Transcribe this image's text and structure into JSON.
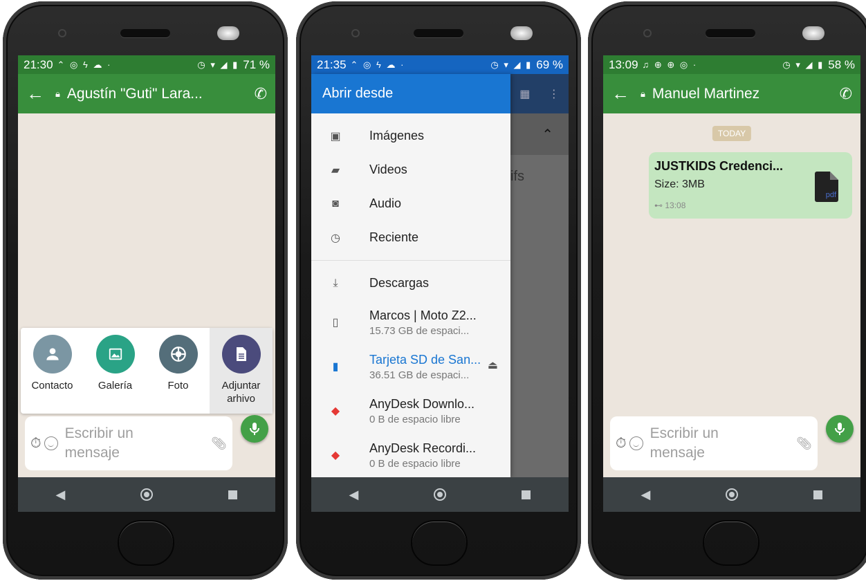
{
  "phone1": {
    "status": {
      "time": "21:30",
      "left_icons": "⌃ ◎ ϟ ☁ ·",
      "right_icons": "◷ ▾ ◢ ▮",
      "battery": "71 %"
    },
    "header": {
      "title": "Agustín \"Guti\" Lara..."
    },
    "attach": [
      {
        "label": "Contacto",
        "color": "#7b96a3"
      },
      {
        "label": "Galería",
        "color": "#2aa386"
      },
      {
        "label": "Foto",
        "color": "#546e7a"
      },
      {
        "label": "Adjuntar arhivo",
        "color": "#4b4b7c"
      }
    ],
    "input": {
      "placeholder_line1": "Escribir un",
      "placeholder_line2": "mensaje"
    }
  },
  "phone2": {
    "status": {
      "time": "21:35",
      "left_icons": "⌃ ◎ ϟ ☁ ·",
      "right_icons": "◷ ▾ ◢ ▮",
      "battery": "69 %"
    },
    "drawer_title": "Abrir desde",
    "items": [
      {
        "label": "Imágenes",
        "icon": "image-icon"
      },
      {
        "label": "Videos",
        "icon": "video-icon"
      },
      {
        "label": "Audio",
        "icon": "audio-icon"
      },
      {
        "label": "Reciente",
        "icon": "clock-icon"
      }
    ],
    "downloads": "Descargas",
    "storage": [
      {
        "line1": "Marcos | Moto Z2...",
        "line2": "15.73 GB de espaci..."
      },
      {
        "line1": "Tarjeta SD de San...",
        "line2": "36.51 GB de espaci..."
      },
      {
        "line1": "AnyDesk Downlo...",
        "line2": "0 B de espacio libre"
      },
      {
        "line1": "AnyDesk Recordi...",
        "line2": "0 B de espacio libre"
      }
    ],
    "scrim_text": "ifs"
  },
  "phone3": {
    "status": {
      "time": "13:09",
      "left_icons": "♫ ⊕ ⊕ ◎ ·",
      "right_icons": "◷ ▾ ◢ ▮",
      "battery": "58 %"
    },
    "header": {
      "title": "Manuel Martinez"
    },
    "today": "TODAY",
    "message": {
      "filename": "JUSTKIDS Credenci...",
      "size": "Size: 3MB",
      "time": "13:08",
      "doc_label": "pdf"
    },
    "input": {
      "placeholder_line1": "Escribir un",
      "placeholder_line2": "mensaje"
    }
  }
}
